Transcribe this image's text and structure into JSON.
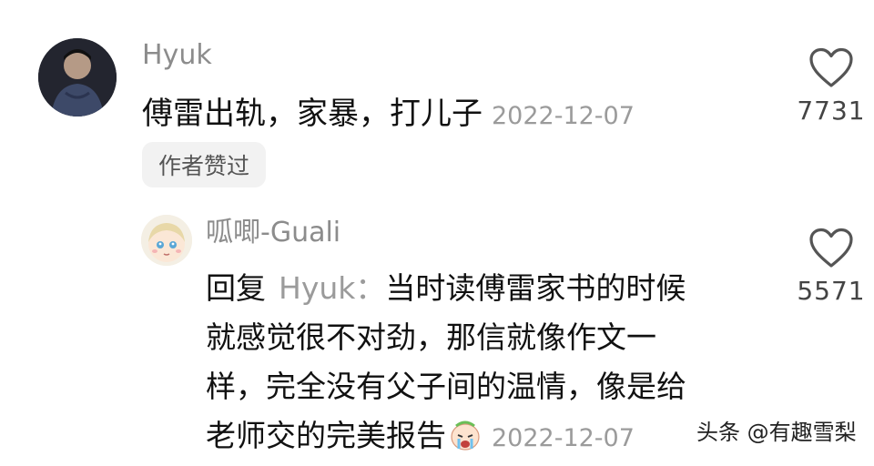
{
  "comment": {
    "username": "Hyuk",
    "text": "傅雷出轨，家暴，打儿子",
    "date": "2022-12-07",
    "badge": "作者赞过",
    "like_count": "7731"
  },
  "reply": {
    "username": "呱唧-Guali",
    "prefix": "回复",
    "target": "Hyuk：",
    "line1": "当时读傅雷家书的时候",
    "line2": "就感觉很不对劲，那信就像作文一",
    "line3": "样，完全没有父子间的温情，像是给",
    "line4": "老师交的完美报告",
    "date": "2022-12-07",
    "like_count": "5571"
  },
  "watermark": "头条 @有趣雪梨",
  "icons": {
    "like": "heart-outline-icon",
    "emoji": "crying-face-emoji-icon"
  },
  "colors": {
    "username": "#8c8c8c",
    "date": "#9b9b9b",
    "badge_bg": "#f2f2f2"
  }
}
